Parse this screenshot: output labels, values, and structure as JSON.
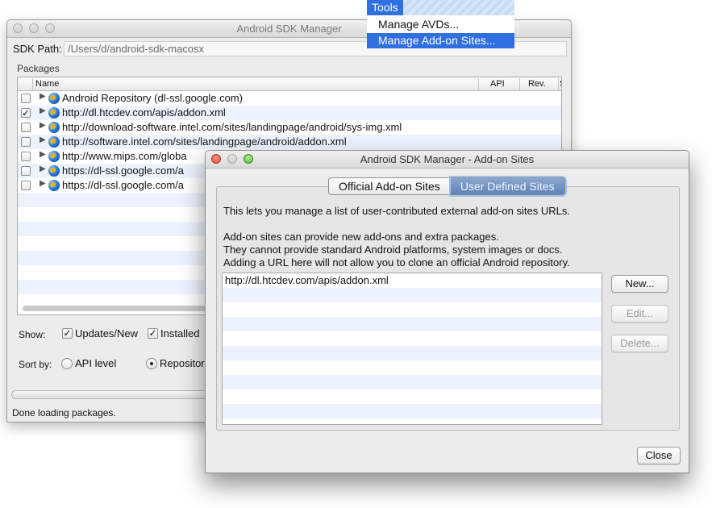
{
  "menu": {
    "title": "Tools",
    "items": [
      {
        "label": "Manage AVDs..."
      },
      {
        "label": "Manage Add-on Sites..."
      }
    ]
  },
  "main_window": {
    "title": "Android SDK Manager",
    "sdk_path_label": "SDK Path:",
    "sdk_path_value": "/Users/d/android-sdk-macosx",
    "packages_label": "Packages",
    "columns": {
      "name": "Name",
      "api": "API",
      "rev": "Rev.",
      "status": "S"
    },
    "rows": [
      {
        "label": "Android Repository (dl-ssl.google.com)",
        "checked": false
      },
      {
        "label": "http://dl.htcdev.com/apis/addon.xml",
        "checked": true
      },
      {
        "label": "http://download-software.intel.com/sites/landingpage/android/sys-img.xml",
        "checked": false
      },
      {
        "label": "http://software.intel.com/sites/landingpage/android/addon.xml",
        "checked": false
      },
      {
        "label": "http://www.mips.com/globa",
        "checked": false
      },
      {
        "label": "https://dl-ssl.google.com/a",
        "checked": false
      },
      {
        "label": "https://dl-ssl.google.com/a",
        "checked": false
      }
    ],
    "show_label": "Show:",
    "show_updates": "Updates/New",
    "show_installed": "Installed",
    "sort_label": "Sort by:",
    "sort_api": "API level",
    "sort_repo": "Repositor",
    "check_mark": "✓",
    "status": "Done loading packages."
  },
  "dialog": {
    "title": "Android SDK Manager - Add-on Sites",
    "tabs": {
      "official": "Official Add-on Sites",
      "user": "User Defined Sites"
    },
    "description": [
      "This lets you manage a list of user-contributed external add-on sites URLs.",
      "Add-on sites can provide new add-ons and extra packages.",
      "They cannot provide standard Android platforms, system images or docs.",
      "Adding a URL here will not allow you to clone an official Android repository."
    ],
    "urls": [
      "http://dl.htcdev.com/apis/addon.xml"
    ],
    "buttons": {
      "new": "New...",
      "edit": "Edit...",
      "delete": "Delete...",
      "close": "Close"
    }
  },
  "colors": {
    "accent": "#2f6fe0",
    "selected_tab": "#5f82b5",
    "row_stripe": "#edf3fe"
  }
}
